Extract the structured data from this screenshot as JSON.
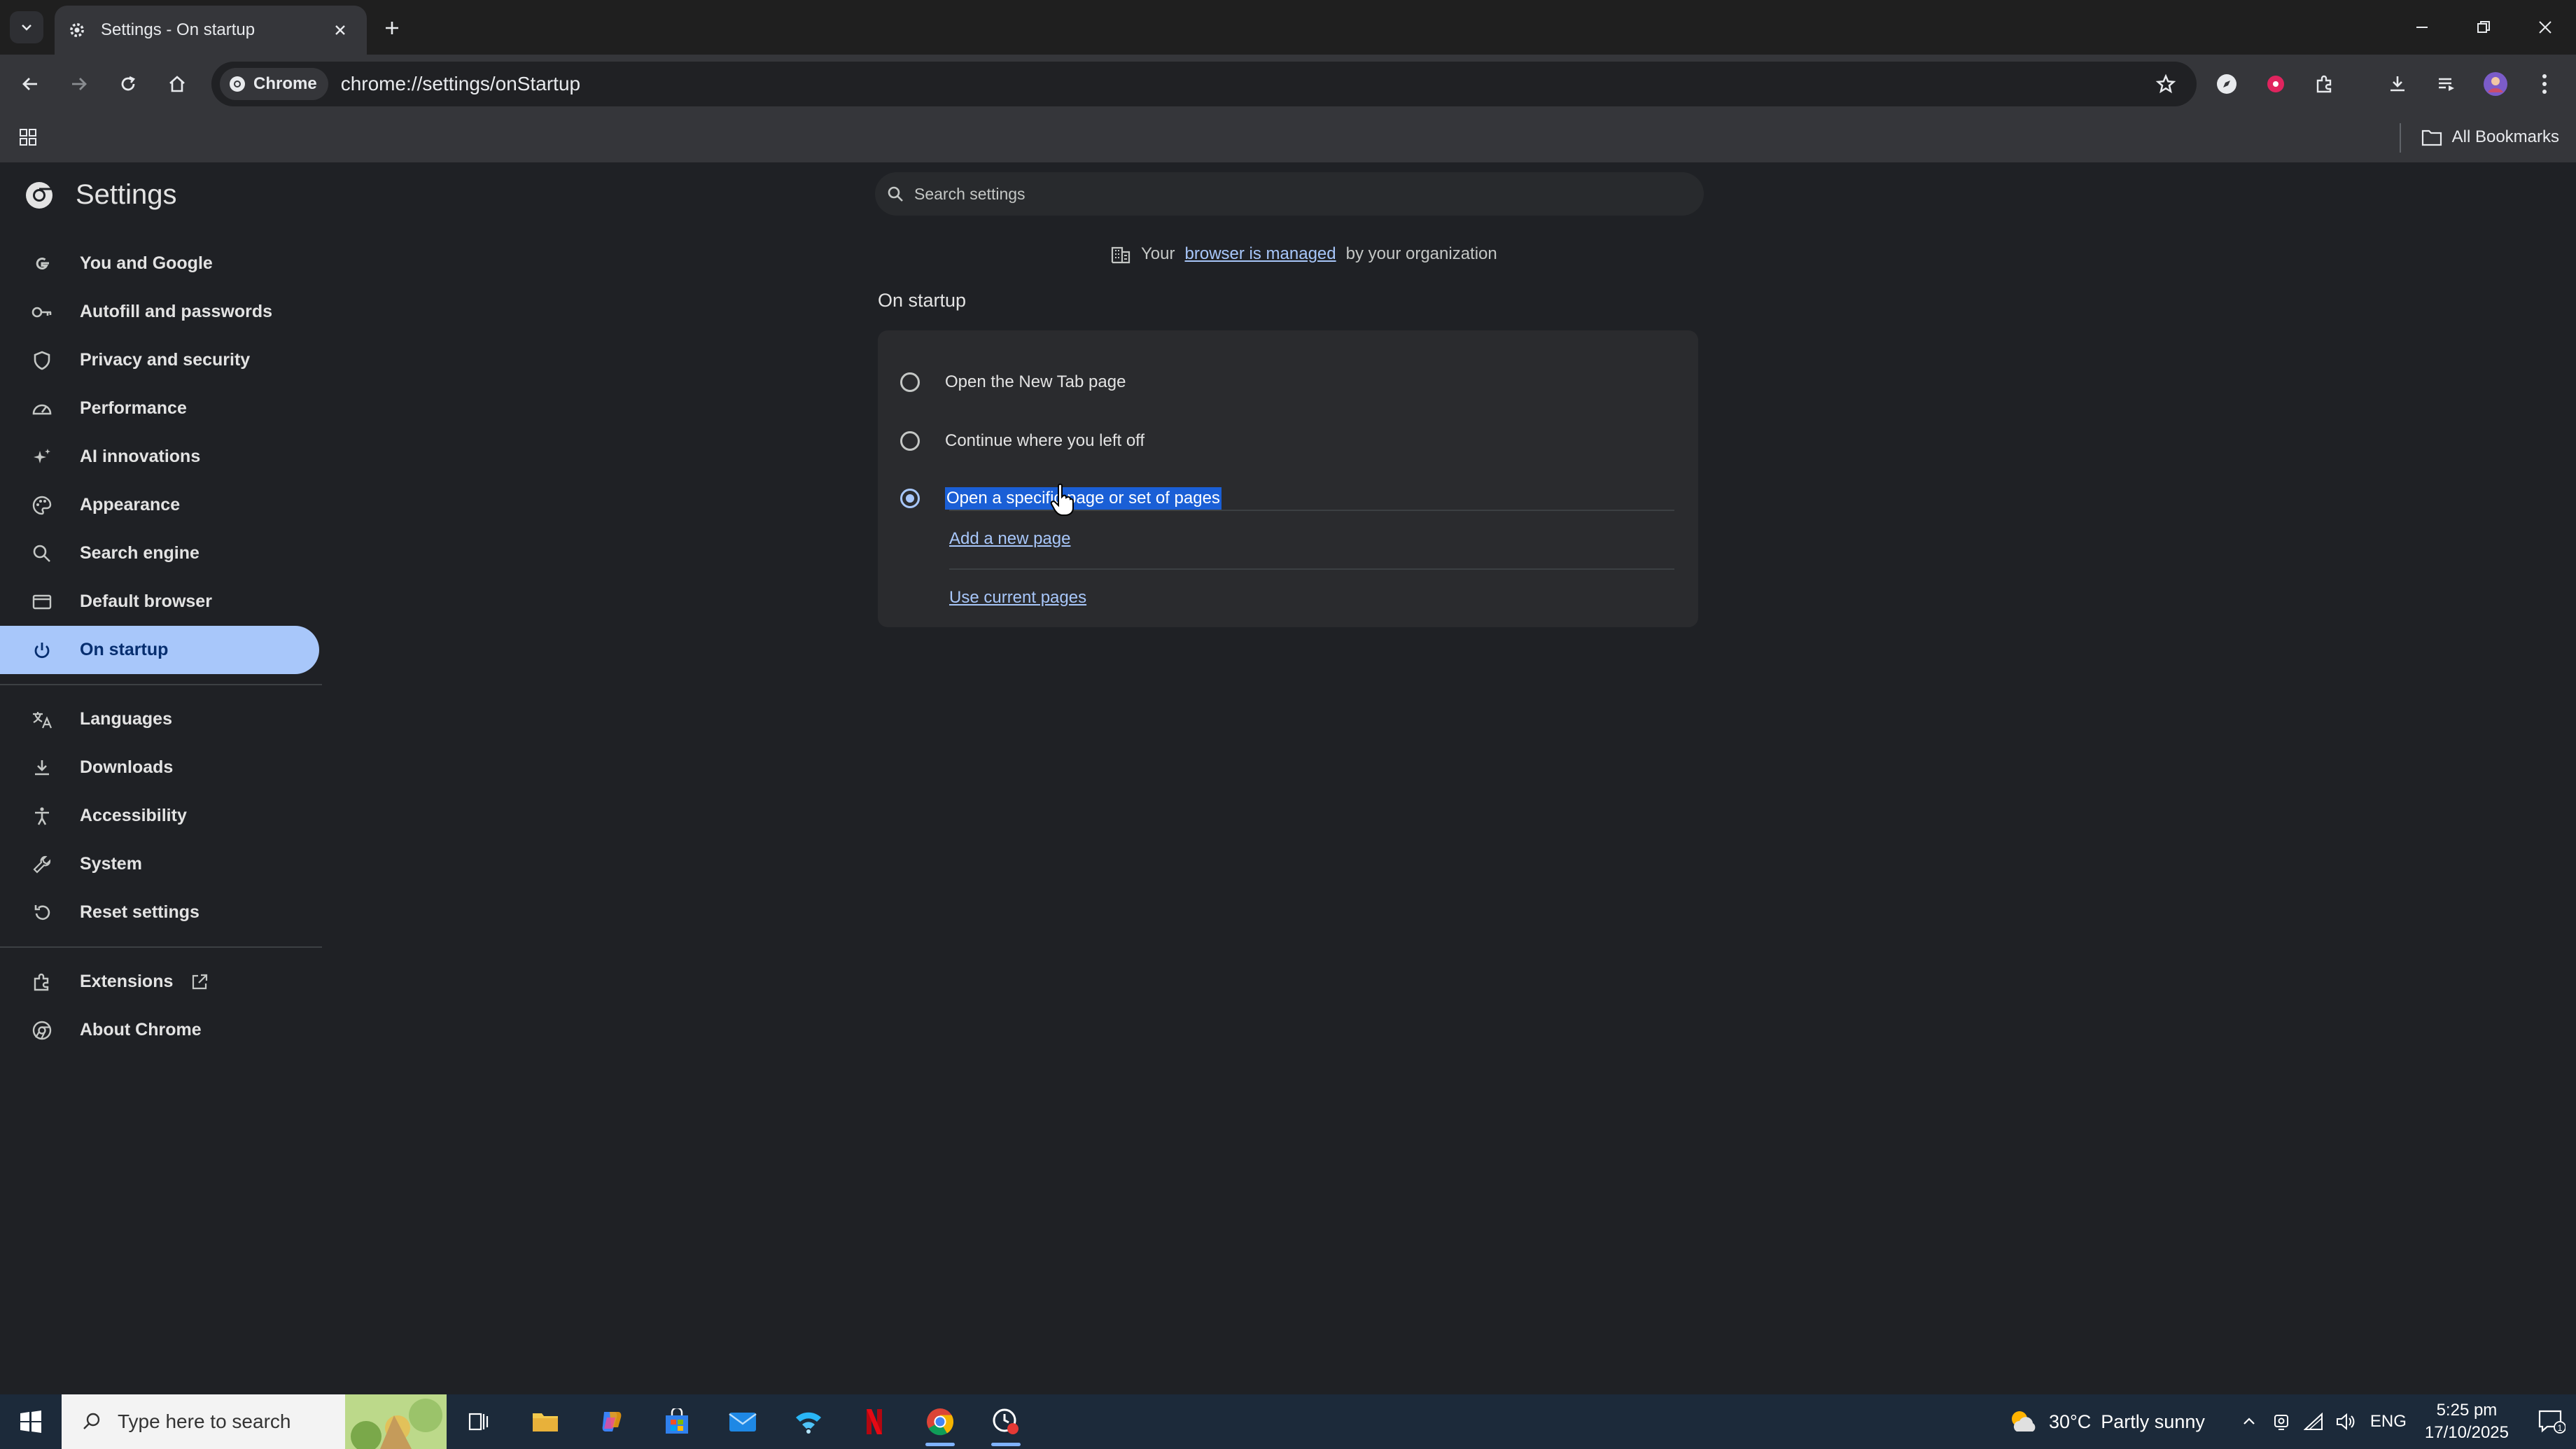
{
  "browser": {
    "tab_title": "Settings - On startup",
    "chip_label": "Chrome",
    "url": "chrome://settings/onStartup",
    "all_bookmarks": "All Bookmarks"
  },
  "settings": {
    "title": "Settings",
    "search_placeholder": "Search settings",
    "managed_prefix": "Your",
    "managed_link": "browser is managed",
    "managed_suffix": "by your organization",
    "nav": [
      {
        "label": "You and Google",
        "icon": "google-icon"
      },
      {
        "label": "Autofill and passwords",
        "icon": "key-icon"
      },
      {
        "label": "Privacy and security",
        "icon": "shield-icon"
      },
      {
        "label": "Performance",
        "icon": "speedometer-icon"
      },
      {
        "label": "AI innovations",
        "icon": "sparkle-icon"
      },
      {
        "label": "Appearance",
        "icon": "palette-icon"
      },
      {
        "label": "Search engine",
        "icon": "search-icon"
      },
      {
        "label": "Default browser",
        "icon": "browser-window-icon"
      },
      {
        "label": "On startup",
        "icon": "power-icon",
        "active": true
      }
    ],
    "nav2": [
      {
        "label": "Languages",
        "icon": "translate-icon"
      },
      {
        "label": "Downloads",
        "icon": "download-icon"
      },
      {
        "label": "Accessibility",
        "icon": "accessibility-icon"
      },
      {
        "label": "System",
        "icon": "wrench-icon"
      },
      {
        "label": "Reset settings",
        "icon": "reset-icon"
      }
    ],
    "nav3": [
      {
        "label": "Extensions",
        "icon": "puzzle-icon"
      },
      {
        "label": "About Chrome",
        "icon": "chrome-icon"
      }
    ],
    "startup": {
      "section_title": "On startup",
      "options": [
        {
          "label": "Open the New Tab page",
          "selected": false
        },
        {
          "label": "Continue where you left off",
          "selected": false
        },
        {
          "label": "Open a specific page or set of pages",
          "selected": true
        }
      ],
      "add_page": "Add a new page",
      "use_current": "Use current pages"
    }
  },
  "taskbar": {
    "search_placeholder": "Type here to search",
    "weather_temp": "30°C",
    "weather_text": "Partly sunny",
    "language": "ENG",
    "time": "5:25 pm",
    "date": "17/10/2025",
    "notification_count": "1"
  },
  "colors": {
    "accent": "#a8c7fa",
    "active_nav_text": "#062e6f",
    "selection": "#1a5fd6"
  }
}
